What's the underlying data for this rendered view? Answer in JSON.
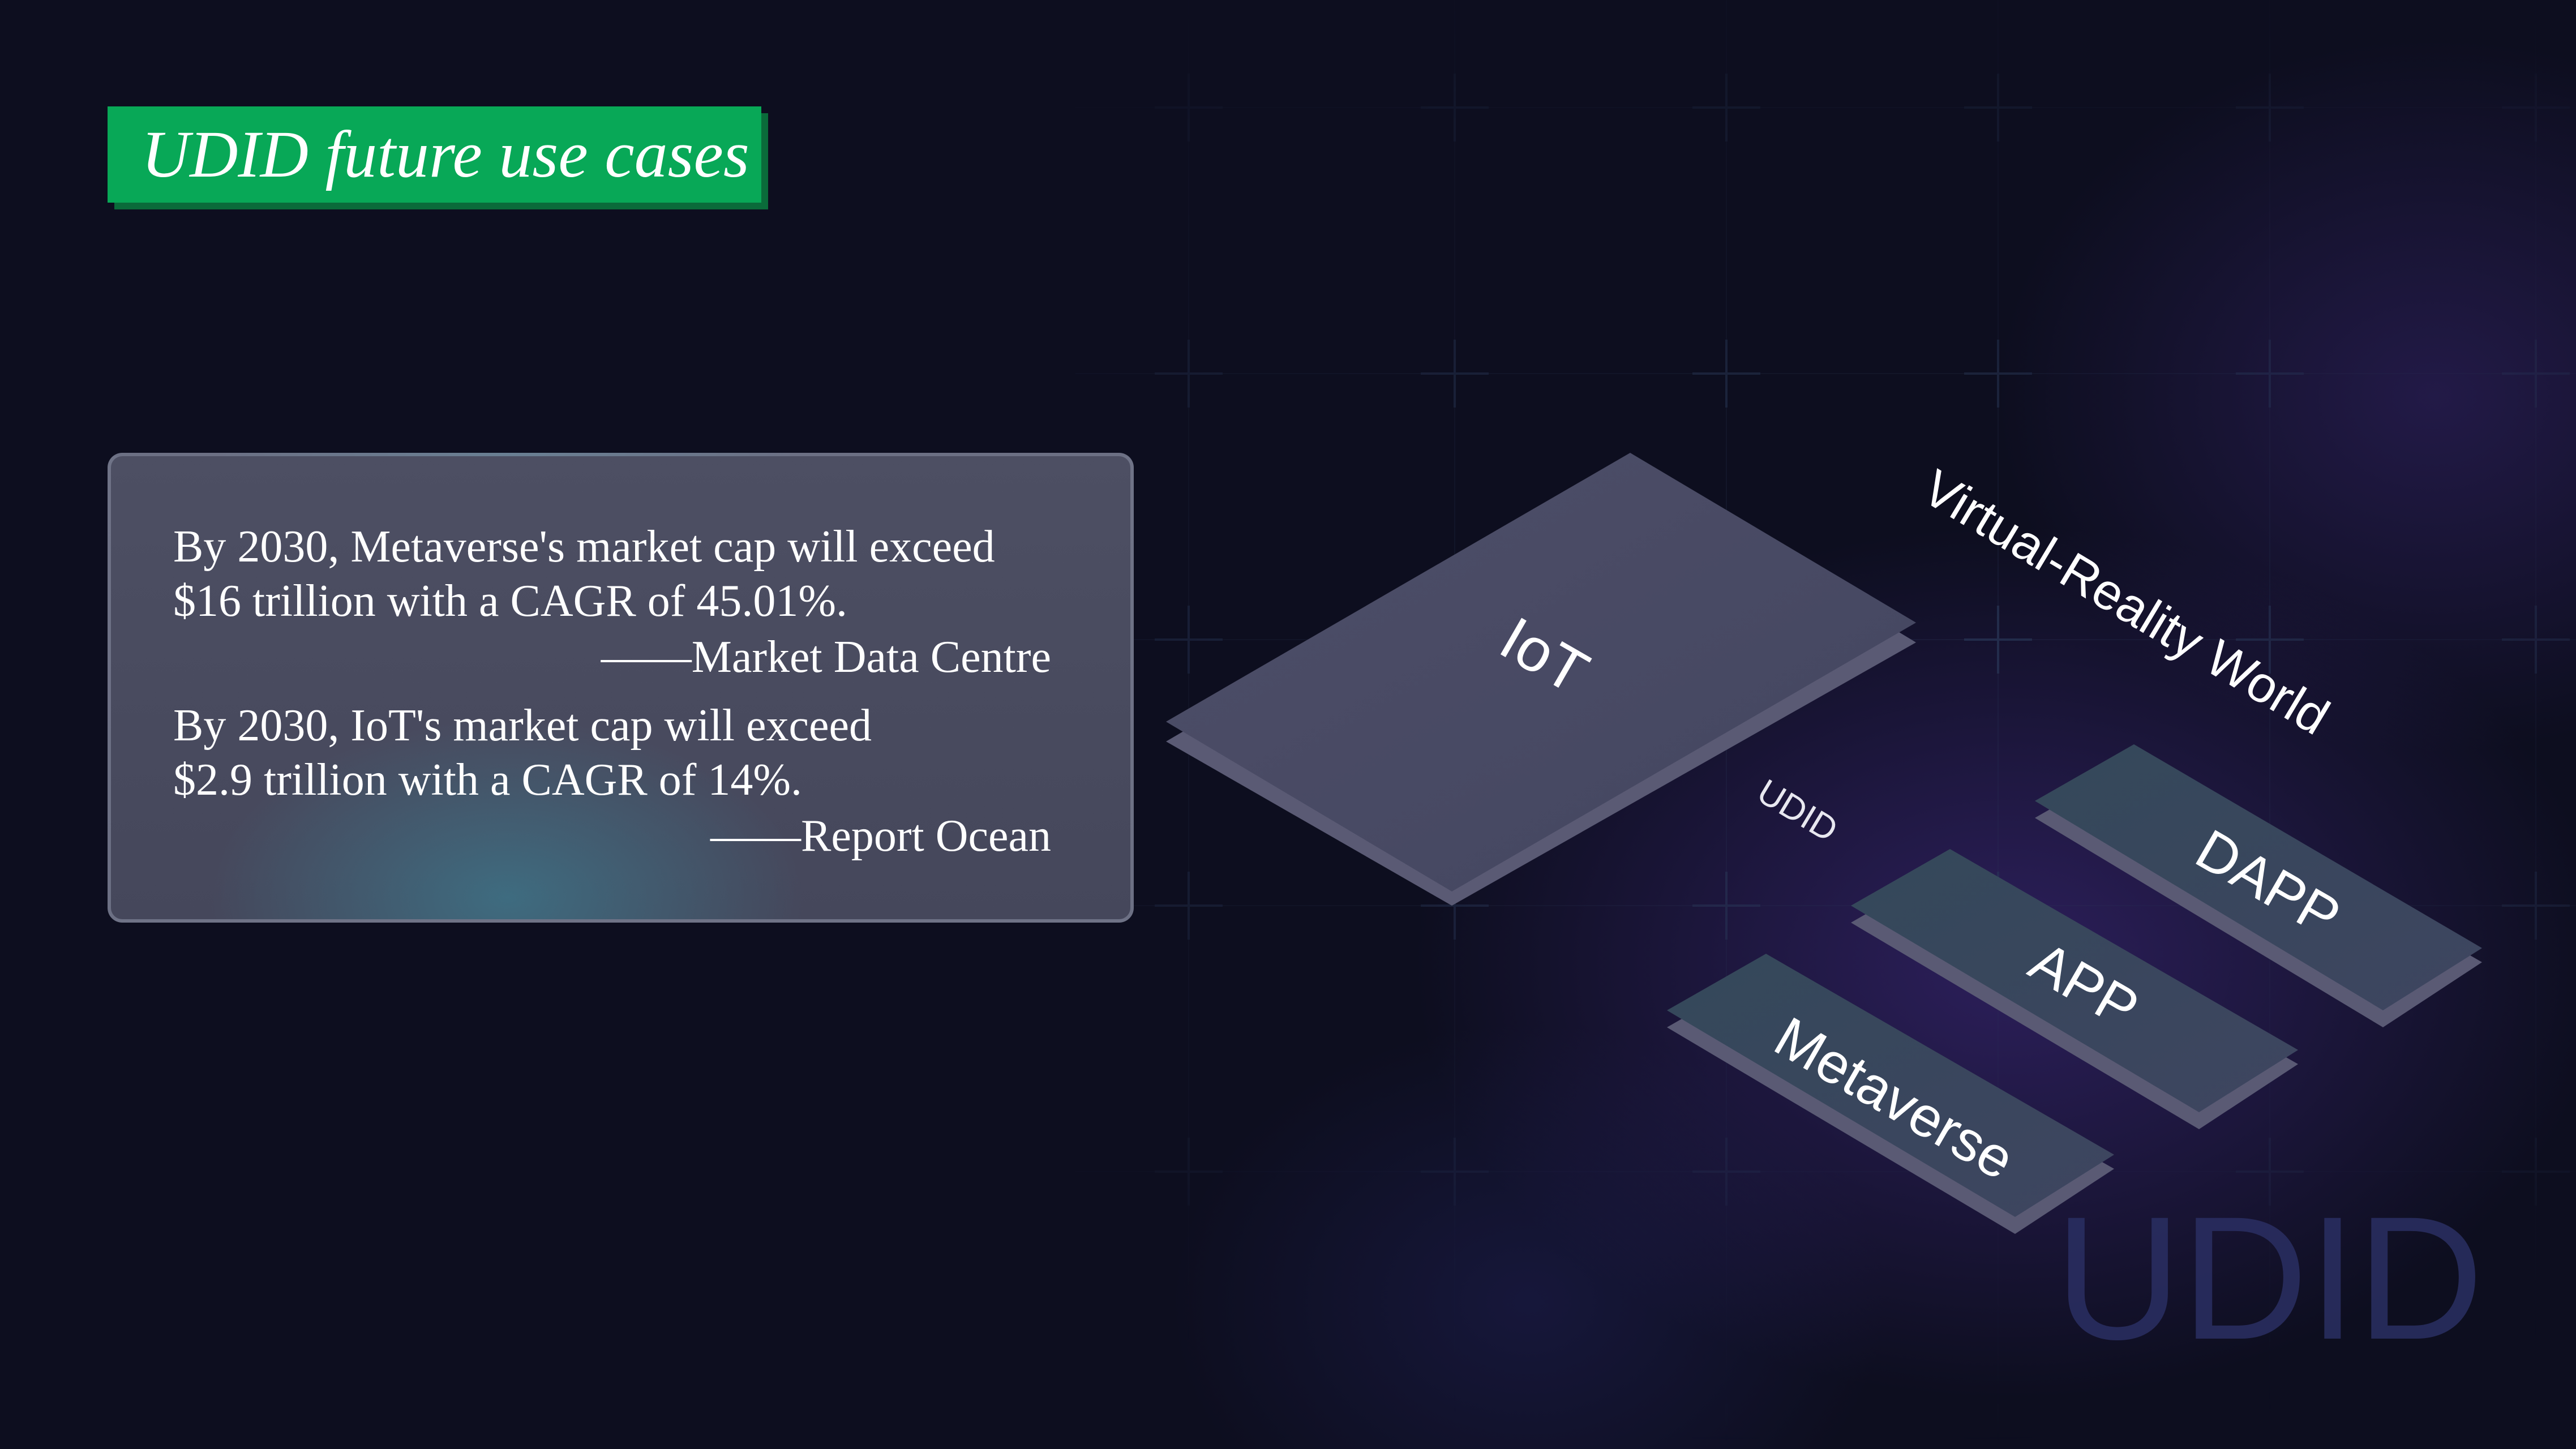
{
  "title": "UDID future use cases",
  "quotes": [
    {
      "line1": "By 2030, Metaverse's market cap will exceed",
      "line2": "$16 trillion with a CAGR of 45.01%.",
      "source": "——Market Data Centre"
    },
    {
      "line1": "By 2030, IoT's market cap will exceed",
      "line2": "$2.9 trillion with a CAGR of 14%.",
      "source": "——Report Ocean"
    }
  ],
  "diagram": {
    "top_layer": "IoT",
    "center_label": "UDID",
    "world_label": "Virtual-Reality World",
    "lower_layers": [
      "Metaverse",
      "APP",
      "DAPP"
    ]
  },
  "watermark": "UDID",
  "colors": {
    "background": "#0d0e1f",
    "title_green": "#08a857",
    "card": "#4a4c60",
    "plate": "#4a4a66",
    "plate_dark": "#3a4a5c"
  }
}
